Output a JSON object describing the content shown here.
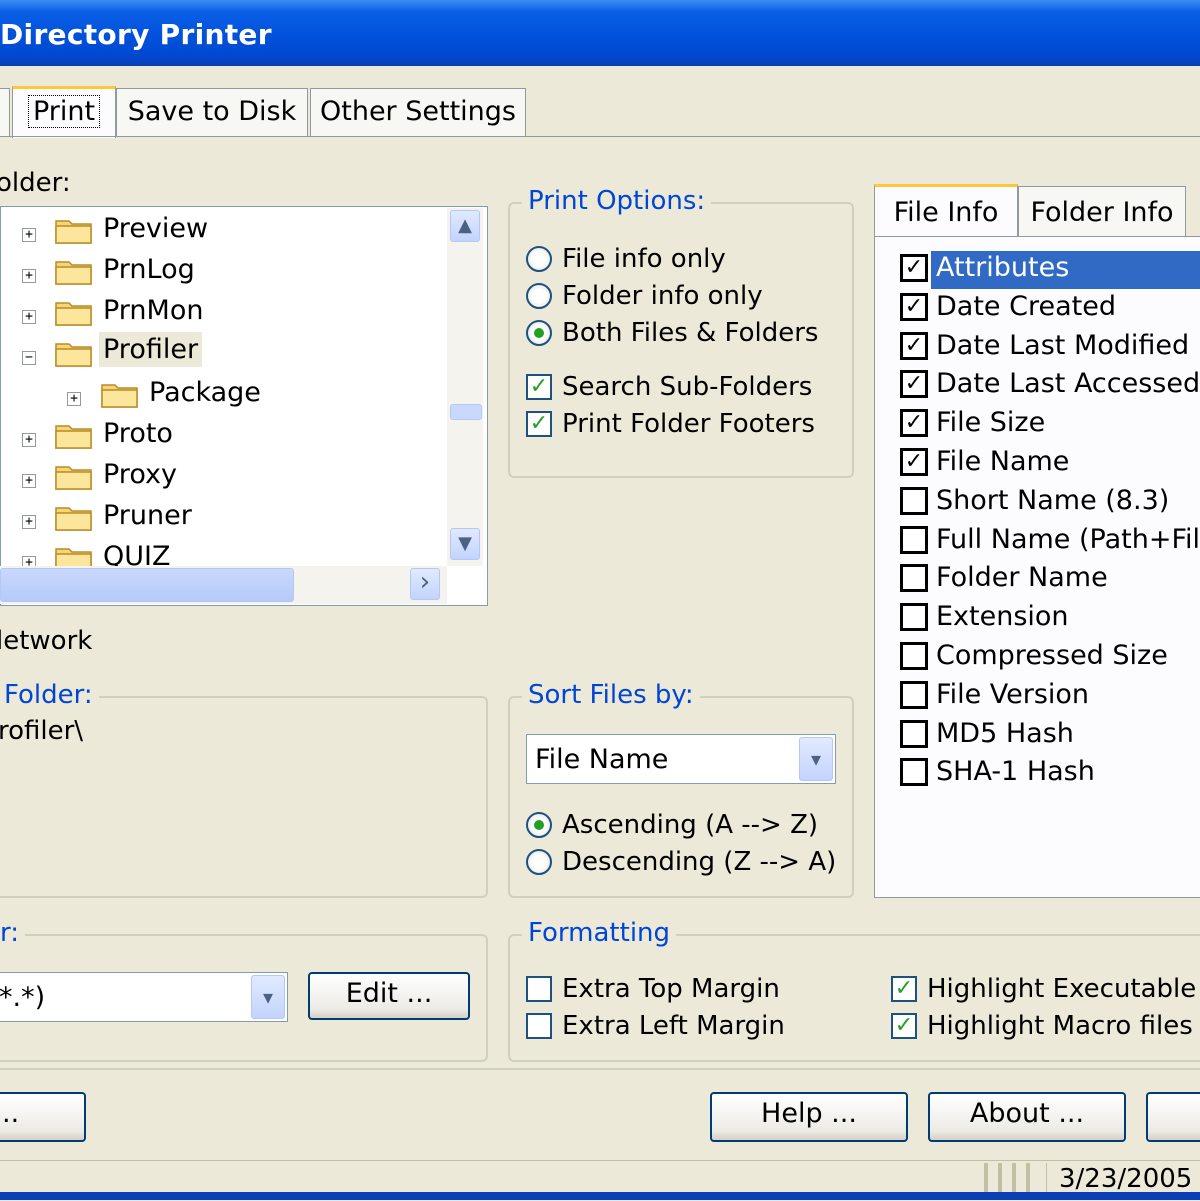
{
  "window": {
    "title": "Directory Printer"
  },
  "tabs": [
    {
      "label": "Print",
      "active": true
    },
    {
      "label": "Save to Disk",
      "active": false
    },
    {
      "label": "Other Settings",
      "active": false
    }
  ],
  "folder_section": {
    "label": "older:"
  },
  "tree": {
    "items": [
      {
        "label": "Preview",
        "expander": "+"
      },
      {
        "label": "PrnLog",
        "expander": "+"
      },
      {
        "label": "PrnMon",
        "expander": "+"
      },
      {
        "label": "Profiler",
        "expander": "−",
        "selected": true
      },
      {
        "label": "Package",
        "expander": "+",
        "child": true
      },
      {
        "label": "Proto",
        "expander": "+"
      },
      {
        "label": "Proxy",
        "expander": "+"
      },
      {
        "label": "Pruner",
        "expander": "+"
      },
      {
        "label": "QUIZ",
        "expander": "+"
      }
    ]
  },
  "network_label": "letwork",
  "current_folder": {
    "title": "Folder:",
    "path": "rofiler\\"
  },
  "print_options": {
    "title": "Print Options:",
    "radios": [
      {
        "label": "File info only",
        "selected": false
      },
      {
        "label": "Folder info only",
        "selected": false
      },
      {
        "label": "Both Files & Folders",
        "selected": true
      }
    ],
    "checks": [
      {
        "label": "Search Sub-Folders",
        "checked": true
      },
      {
        "label": "Print Folder Footers",
        "checked": true
      }
    ]
  },
  "sort": {
    "title": "Sort Files by:",
    "field_value": "File Name",
    "radios": [
      {
        "label": "Ascending (A --> Z)",
        "selected": true
      },
      {
        "label": "Descending (Z --> A)",
        "selected": false
      }
    ]
  },
  "info_tabs": [
    {
      "label": "File Info",
      "active": true
    },
    {
      "label": "Folder Info",
      "active": false
    }
  ],
  "file_info_fields": [
    {
      "label": "Attributes",
      "checked": true,
      "highlighted": true
    },
    {
      "label": "Date Created",
      "checked": true
    },
    {
      "label": "Date Last Modified",
      "checked": true
    },
    {
      "label": "Date Last Accessed",
      "checked": true
    },
    {
      "label": "File Size",
      "checked": true
    },
    {
      "label": "File Name",
      "checked": true
    },
    {
      "label": "Short Name (8.3)",
      "checked": false
    },
    {
      "label": "Full Name (Path+File",
      "checked": false
    },
    {
      "label": "Folder Name",
      "checked": false
    },
    {
      "label": "Extension",
      "checked": false
    },
    {
      "label": "Compressed Size",
      "checked": false
    },
    {
      "label": "File Version",
      "checked": false
    },
    {
      "label": "MD5 Hash",
      "checked": false
    },
    {
      "label": "SHA-1 Hash",
      "checked": false
    }
  ],
  "filter": {
    "title": "r:",
    "value": "*.*)",
    "edit_label": "Edit ..."
  },
  "formatting": {
    "title": "Formatting",
    "left_checks": [
      {
        "label": "Extra Top Margin",
        "checked": false
      },
      {
        "label": "Extra Left Margin",
        "checked": false
      }
    ],
    "right_checks": [
      {
        "label": "Highlight Executable fi",
        "checked": true
      },
      {
        "label": "Highlight Macro files",
        "checked": true
      }
    ]
  },
  "buttons": {
    "left_partial": "..",
    "help": "Help ...",
    "about": "About ..."
  },
  "status": {
    "date": "3/23/2005"
  },
  "icons": {
    "check_mark": "✓",
    "scroll_up": "▲",
    "scroll_down": "▼",
    "scroll_right": "›",
    "combo_arrow": "▾"
  }
}
